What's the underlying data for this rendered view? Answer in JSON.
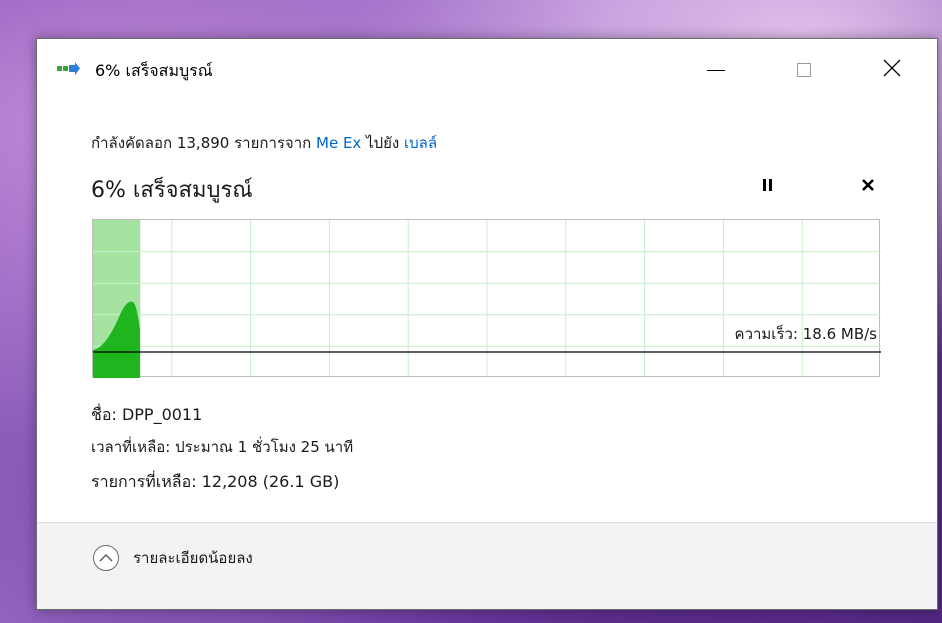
{
  "window": {
    "title": "6% เสร็จสมบูรณ์"
  },
  "copy_status": {
    "prefix": "กำลังคัดลอก 13,890 รายการจาก ",
    "source": "Me Ex",
    "middle": " ไปยัง ",
    "destination": "เบลล์"
  },
  "progress": {
    "heading": "6% เสร็จสมบูรณ์",
    "percent": 6
  },
  "speed": {
    "label": "ความเร็ว: 18.6 MB/s"
  },
  "details": {
    "name": "ชื่อ: DPP_0011",
    "time_remaining": "เวลาที่เหลือ: ประมาณ 1 ชั่วโมง 25 นาที",
    "items_remaining": "รายการที่เหลือ: 12,208 (26.1 GB)"
  },
  "footer": {
    "toggle_label": "รายละเอียดน้อยลง"
  },
  "icons": {
    "title": "file-copy-icon",
    "minimize": "minimize-icon",
    "maximize": "maximize-icon",
    "close": "close-icon",
    "pause": "pause-icon",
    "stop": "stop-icon",
    "toggle": "chevron-up-icon"
  },
  "colors": {
    "progress_fill": "#a6e3a1",
    "speed_area": "#1fb51f",
    "grid_line": "#c8eec8",
    "link": "#0066cc"
  }
}
